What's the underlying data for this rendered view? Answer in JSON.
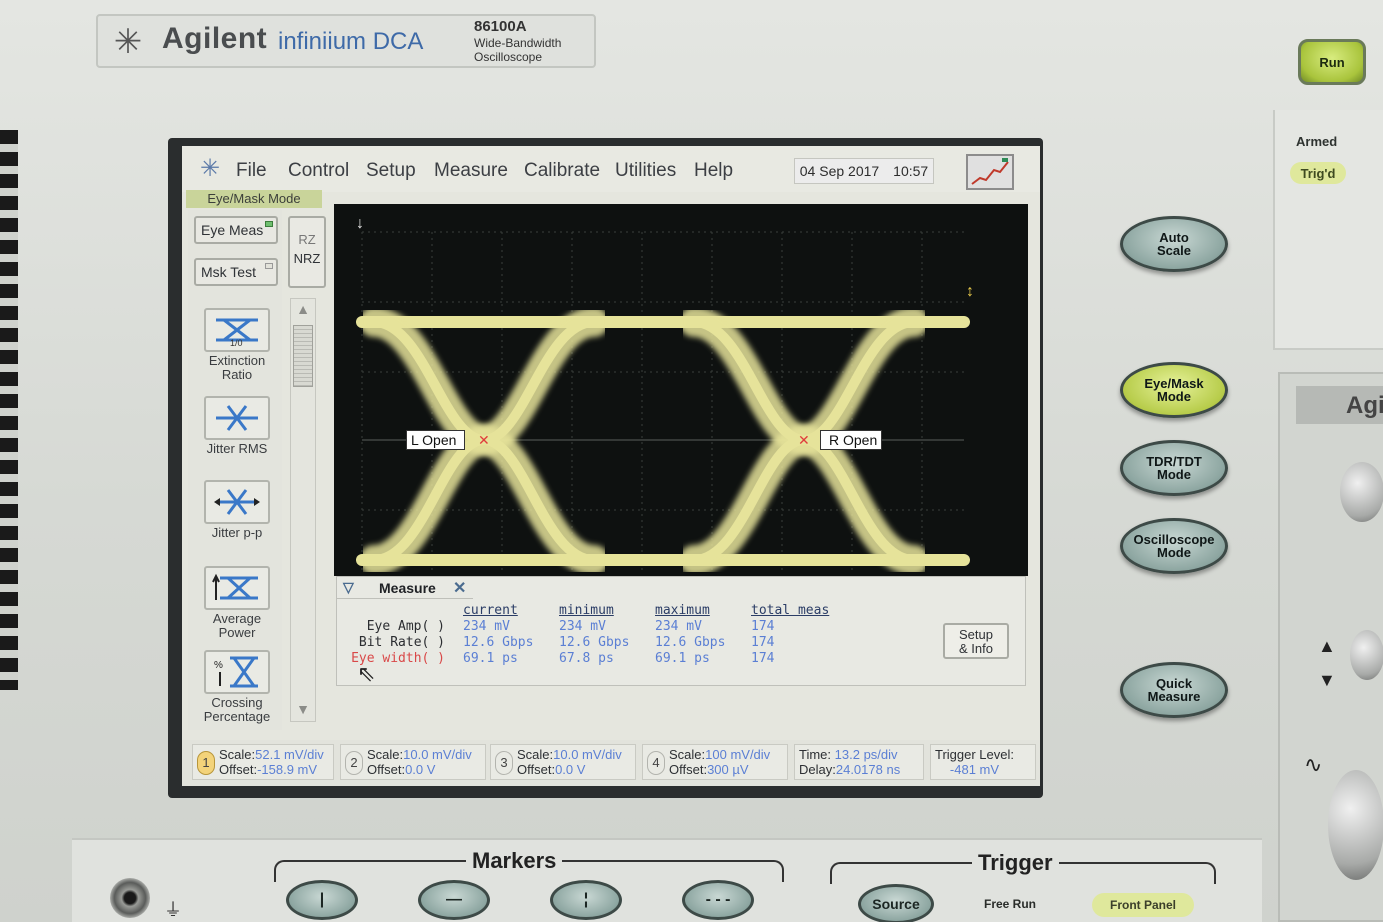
{
  "brand": {
    "logo_icon": "agilent-spark-icon",
    "name": "Agilent",
    "product": "infiniium DCA",
    "model": "86100A",
    "description": [
      "Wide-Bandwidth",
      "Oscilloscope"
    ]
  },
  "hardware": {
    "run_label": "Run",
    "armed_label": "Armed",
    "trigd_label": "Trig'd",
    "auto_scale": [
      "Auto",
      "Scale"
    ],
    "eye_mask_mode": [
      "Eye/Mask",
      "Mode"
    ],
    "tdr_tdt_mode": [
      "TDR/TDT",
      "Mode"
    ],
    "oscilloscope_mode": [
      "Oscilloscope",
      "Mode"
    ],
    "quick_measure": [
      "Quick",
      "Measure"
    ],
    "second_unit_brand": "Agi"
  },
  "menu": {
    "items": [
      "File",
      "Control",
      "Setup",
      "Measure",
      "Calibrate",
      "Utilities",
      "Help"
    ],
    "date": "04 Sep 2017",
    "time": "10:57"
  },
  "mode_label": "Eye/Mask Mode",
  "toolbar": {
    "eye_meas": "Eye Meas",
    "msk_test": "Msk Test",
    "rz": "RZ",
    "nrz": "NRZ",
    "tools": [
      {
        "icon": "extinction-ratio-icon",
        "label": [
          "Extinction",
          "Ratio"
        ]
      },
      {
        "icon": "jitter-rms-icon",
        "label": [
          "Jitter RMS"
        ]
      },
      {
        "icon": "jitter-pp-icon",
        "label": [
          "Jitter p-p"
        ]
      },
      {
        "icon": "average-power-icon",
        "label": [
          "Average",
          "Power"
        ]
      },
      {
        "icon": "crossing-percentage-icon",
        "label": [
          "Crossing",
          "Percentage"
        ]
      }
    ]
  },
  "waveform": {
    "left_marker": "L Open",
    "right_marker": "R Open",
    "trace_color": "#e6e39a",
    "marker_color": "#e03c3c"
  },
  "measure_panel": {
    "title": "Measure",
    "columns": [
      "current",
      "minimum",
      "maximum",
      "total meas"
    ],
    "rows": [
      {
        "label": "Eye Amp( )",
        "highlight": false,
        "values": [
          "234 mV",
          "234 mV",
          "234 mV",
          "174"
        ]
      },
      {
        "label": "Bit Rate( )",
        "highlight": false,
        "values": [
          "12.6 Gbps",
          "12.6 Gbps",
          "12.6 Gbps",
          "174"
        ]
      },
      {
        "label": "Eye width( )",
        "highlight": true,
        "values": [
          "69.1 ps",
          "67.8 ps",
          "69.1 ps",
          "174"
        ]
      }
    ],
    "setup_info": [
      "Setup",
      "& Info"
    ]
  },
  "status_bar": {
    "channels": [
      {
        "num": "1",
        "active": true,
        "scale": "52.1 mV/div",
        "offset": "-158.9 mV"
      },
      {
        "num": "2",
        "active": false,
        "scale": "10.0 mV/div",
        "offset": "0.0 V"
      },
      {
        "num": "3",
        "active": false,
        "scale": "10.0 mV/div",
        "offset": "0.0 V"
      },
      {
        "num": "4",
        "active": false,
        "scale": "100 mV/div",
        "offset": "300 µV"
      }
    ],
    "time": "13.2 ps/div",
    "delay": "24.0178 ns",
    "trigger_level_label": "Trigger Level:",
    "trigger_level": "-481 mV",
    "labels": {
      "scale": "Scale:",
      "offset": "Offset:",
      "time": "Time:",
      "delay": "Delay:"
    }
  },
  "bottom_panel": {
    "markers_title": "Markers",
    "marker_keys": [
      "|",
      "—",
      "¦",
      "- - -"
    ],
    "trigger_title": "Trigger",
    "source_label": "Source",
    "free_run_label": "Free Run",
    "front_panel_label": "Front Panel"
  }
}
